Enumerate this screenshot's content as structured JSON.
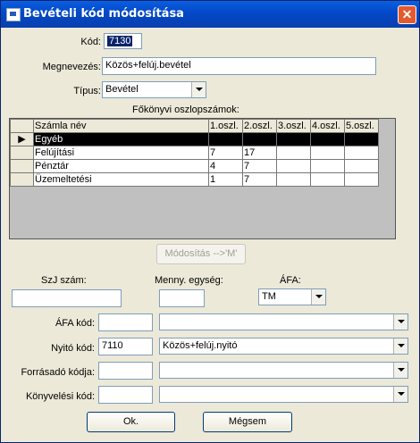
{
  "window": {
    "title": "Bevételi kód módosítása",
    "close_label": "✕"
  },
  "fields": {
    "kod_label": "Kód:",
    "kod_value": "7130",
    "megnevezes_label": "Megnevezés:",
    "megnevezes_value": "Közös+felúj.bevétel",
    "tipus_label": "Típus:",
    "tipus_value": "Bevétel"
  },
  "grid": {
    "title": "Főkönyvi oszlopszámok:",
    "columns": [
      "Számla név",
      "1.oszl.",
      "2.oszl.",
      "3.oszl.",
      "4.oszl.",
      "5.oszl."
    ],
    "rows": [
      {
        "name": "Egyéb",
        "c1": "",
        "c2": "",
        "c3": "",
        "c4": "",
        "c5": "",
        "selected": true
      },
      {
        "name": "Felújítási",
        "c1": "7",
        "c2": "17",
        "c3": "",
        "c4": "",
        "c5": ""
      },
      {
        "name": "Pénztár",
        "c1": "4",
        "c2": "7",
        "c3": "",
        "c4": "",
        "c5": ""
      },
      {
        "name": "Üzemeltetési",
        "c1": "1",
        "c2": "7",
        "c3": "",
        "c4": "",
        "c5": ""
      }
    ]
  },
  "modify_button": "Módosítás -->'M'",
  "lower": {
    "szj_label": "SzJ szám:",
    "szj_value": "",
    "menny_label": "Menny. egység:",
    "menny_value": "",
    "afa_label": "ÁFA:",
    "afa_value": "TM",
    "afa_kod_label": "ÁFA kód:",
    "afa_kod_value": "",
    "afa_kod_select": "",
    "nyito_label": "Nyitó kód:",
    "nyito_value": "7110",
    "nyito_select": "Közös+felúj.nyitó",
    "forras_label": "Forrásadó kódja:",
    "forras_value": "",
    "forras_select": "",
    "konyv_label": "Könyvelési kód:",
    "konyv_value": "",
    "konyv_select": ""
  },
  "buttons": {
    "ok": "Ok.",
    "cancel": "Mégsem"
  }
}
